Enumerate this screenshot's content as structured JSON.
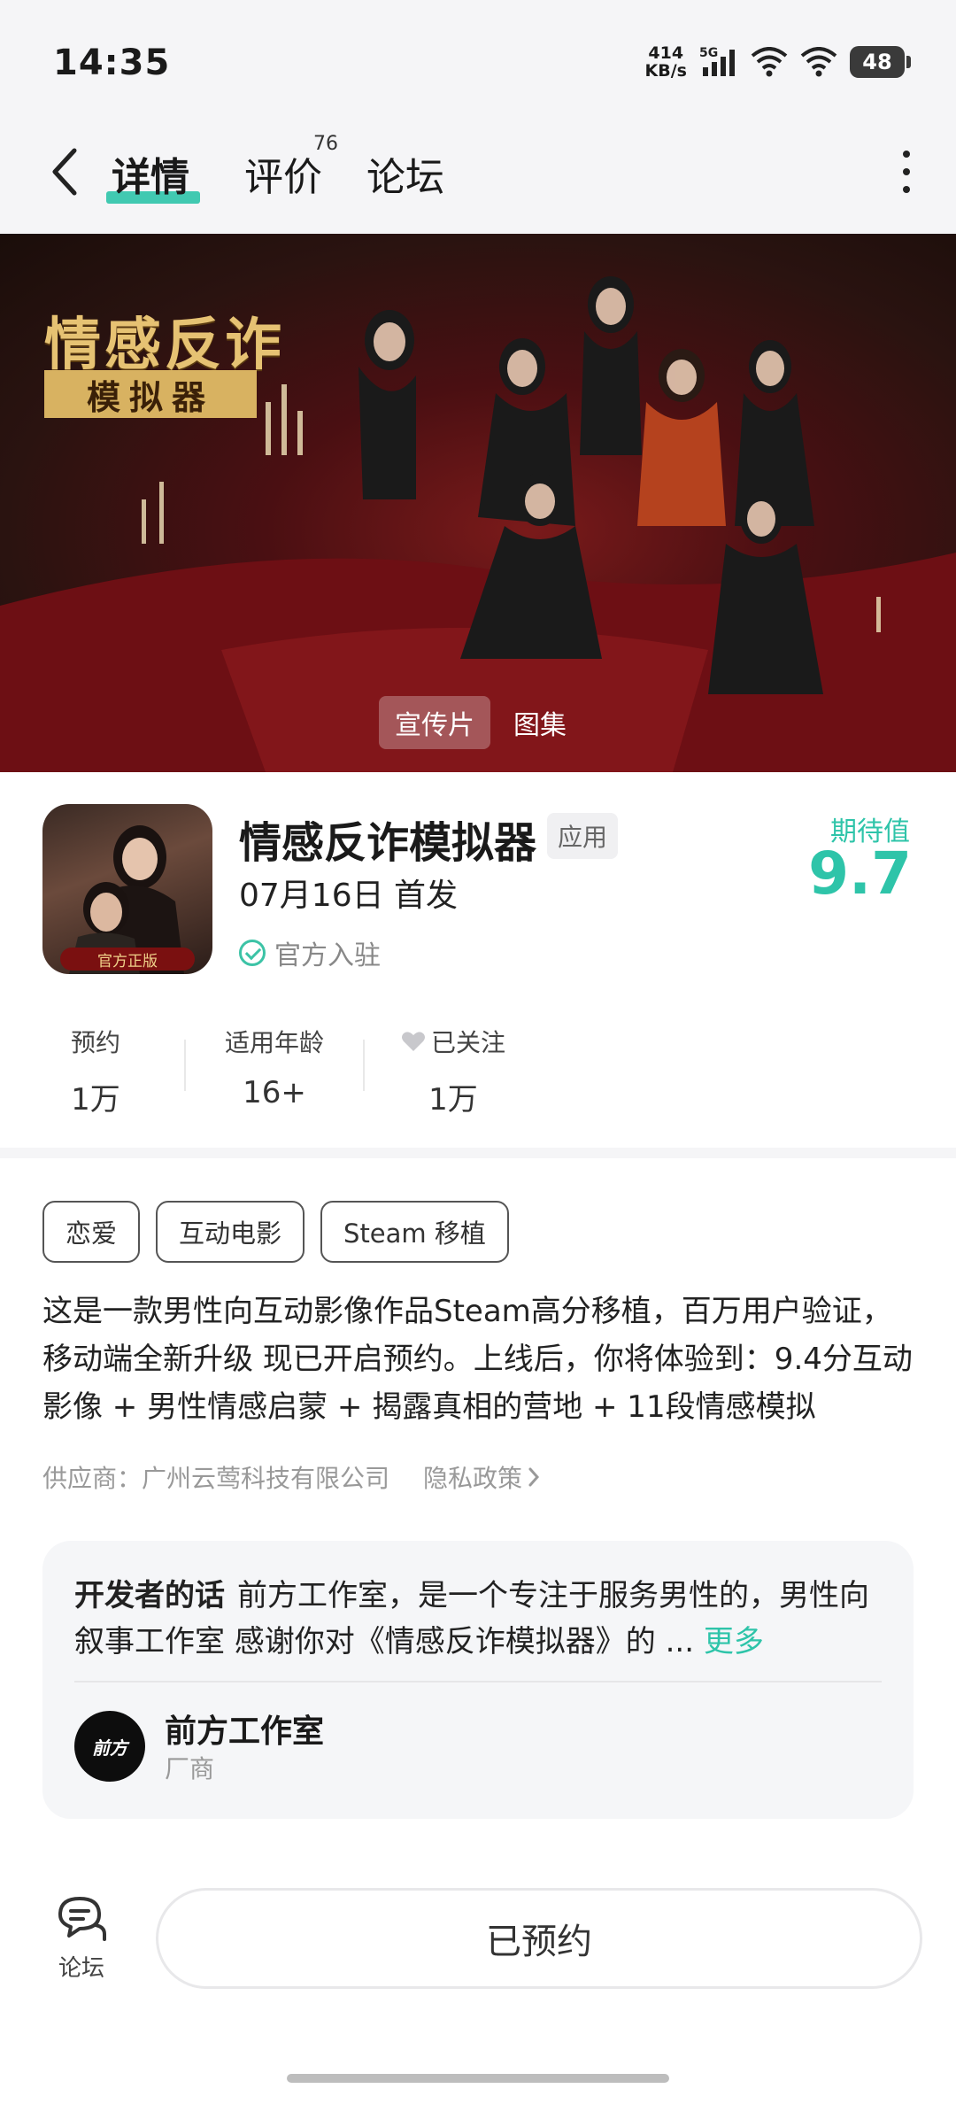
{
  "status_bar": {
    "time": "14:35",
    "net_speed_value": "414",
    "net_speed_unit": "KB/s",
    "network": "5G",
    "battery": "48"
  },
  "nav": {
    "tabs": [
      {
        "label": "详情",
        "active": true
      },
      {
        "label": "评价",
        "count": "76"
      },
      {
        "label": "论坛"
      }
    ]
  },
  "banner": {
    "title": "情感反诈",
    "subtitle": "模拟器",
    "media_tabs": [
      "宣传片",
      "图集"
    ],
    "active_media": "宣传片"
  },
  "app": {
    "icon_badge": "官方正版",
    "name": "情感反诈模拟器",
    "type_tag": "应用",
    "release": "07月16日 首发",
    "official": "官方入驻",
    "expect_label": "期待值",
    "expect_score": "9.7",
    "accent_color": "#2ec4a9"
  },
  "stats": [
    {
      "label": "预约",
      "value": "1万"
    },
    {
      "label": "适用年龄",
      "value": "16+"
    },
    {
      "label": "已关注",
      "value": "1万",
      "icon": "heart-icon"
    }
  ],
  "tags": [
    "恋爱",
    "互动电影",
    "Steam 移植"
  ],
  "description": "这是一款男性向互动影像作品Steam高分移植，百万用户验证，移动端全新升级 现已开启预约。上线后，你将体验到：9.4分互动影像 + 男性情感启蒙 + 揭露真相的营地 + 11段情感模拟",
  "supplier": {
    "text": "供应商：广州云莺科技有限公司",
    "privacy": "隐私政策"
  },
  "developer": {
    "heading": "开发者的话",
    "text": "前方工作室，是一个专注于服务男性的，男性向叙事工作室 感谢你对《情感反诈模拟器》的 ...",
    "more": "更多",
    "avatar_text": "前方",
    "name": "前方工作室",
    "role": "厂商"
  },
  "bottom": {
    "forum_label": "论坛",
    "reserve_label": "已预约"
  }
}
